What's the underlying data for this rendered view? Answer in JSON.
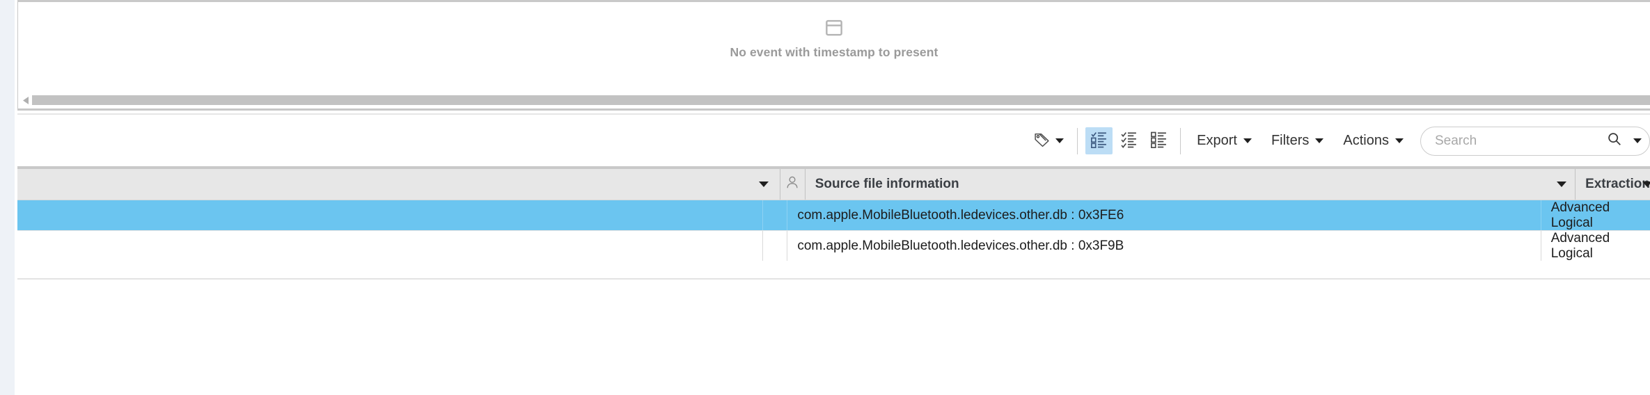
{
  "empty_state": {
    "icon": "window-panel-icon",
    "message": "No event with timestamp to present"
  },
  "scrollbar": {
    "left_arrow_icon": "scroll-left-arrow-icon"
  },
  "toolbar": {
    "tag_icon": "tag-icon",
    "tag_caret_icon": "chevron-down-icon",
    "view_modes": [
      {
        "name": "list-view-checked-icon",
        "active": true
      },
      {
        "name": "list-view-check-rows-icon",
        "active": false
      },
      {
        "name": "list-view-boxes-icon",
        "active": false
      }
    ],
    "menus": [
      {
        "label": "Export",
        "caret_icon": "chevron-down-icon"
      },
      {
        "label": "Filters",
        "caret_icon": "chevron-down-icon"
      },
      {
        "label": "Actions",
        "caret_icon": "chevron-down-icon"
      }
    ],
    "search": {
      "value": "",
      "placeholder": "Search",
      "search_icon": "search-icon",
      "caret_icon": "chevron-down-icon"
    }
  },
  "table": {
    "columns": [
      {
        "key": "blank",
        "label": "",
        "has_caret": true,
        "icon": null
      },
      {
        "key": "person",
        "label": "",
        "has_caret": false,
        "icon": "person-icon"
      },
      {
        "key": "source",
        "label": "Source file information",
        "has_caret": true,
        "icon": null
      },
      {
        "key": "extract",
        "label": "Extraction",
        "has_caret": true,
        "icon": null
      }
    ],
    "rows": [
      {
        "blank": "",
        "source": "com.apple.MobileBluetooth.ledevices.other.db : 0x3FE6",
        "extraction": "Advanced Logical",
        "selected": true
      },
      {
        "blank": "",
        "source": "com.apple.MobileBluetooth.ledevices.other.db : 0x3F9B",
        "extraction": "Advanced Logical",
        "selected": false
      }
    ]
  },
  "colors": {
    "selection": "#6bc5f0",
    "header_bg": "#e7e7e7",
    "toggle_active": "#bcddf5",
    "rail": "#eef2f7"
  }
}
